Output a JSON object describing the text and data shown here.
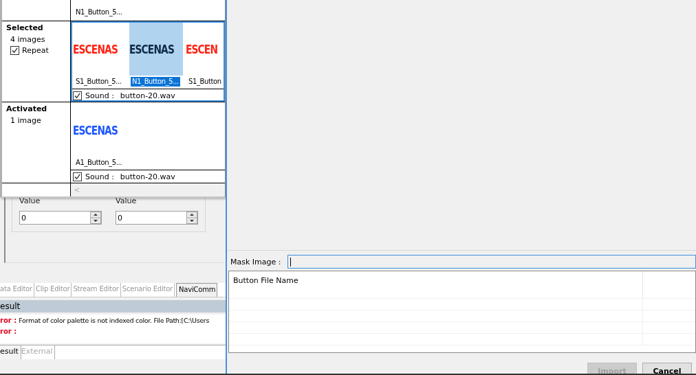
{
  "background_app": {
    "value_fields": [
      {
        "label": "Value",
        "value": "0"
      },
      {
        "label": "Value",
        "value": "0"
      }
    ],
    "editor_tabs": [
      {
        "label": "ata Editor",
        "selected": false
      },
      {
        "label": "Clip Editor",
        "selected": false
      },
      {
        "label": "Stream Editor",
        "selected": false
      },
      {
        "label": "Scenario Editor",
        "selected": false
      },
      {
        "label": "NaviComm",
        "selected": true
      }
    ],
    "result_panel": {
      "title": "esult",
      "messages": [
        {
          "level": "ror :",
          "text": "Format of color palette is not indexed color. File Path:[C:\\Users"
        },
        {
          "level": "ror :"
        }
      ]
    },
    "bottom_tabs": [
      {
        "label": "esult",
        "selected": true
      },
      {
        "label": "External",
        "selected": false
      }
    ]
  },
  "state_table": {
    "top_row": {
      "thumbnails": [
        {
          "label": "N1_Button_5...",
          "selected": false
        }
      ]
    },
    "rows": [
      {
        "state": "Selected",
        "count": "4 images",
        "repeat": {
          "label": "Repeat",
          "checked": true
        },
        "focused": true,
        "thumbnails": [
          {
            "image_text": "ESCENAS",
            "color": "#ff2314",
            "label": "S1_Button_5...",
            "selected": false
          },
          {
            "image_text": "ESCENAS",
            "color": "#0e2a48",
            "label": "N1_Button_5...",
            "selected": true
          },
          {
            "image_text": "ESCEN",
            "color": "#ff2314",
            "label": "S1_Button",
            "selected": false
          }
        ],
        "sound": {
          "label": "Sound :",
          "file": "button-20.wav",
          "checked": true
        }
      },
      {
        "state": "Activated",
        "count": "1 image",
        "focused": false,
        "thumbnails": [
          {
            "image_text": "ESCENAS",
            "color": "#1a55ff",
            "label": "A1_Button_5...",
            "selected": false
          }
        ],
        "sound": {
          "label": "Sound :",
          "file": "button-20.wav",
          "checked": true
        }
      }
    ],
    "scroll_arrow": "<"
  },
  "dialog": {
    "mask_image": {
      "label": "Mask Image :"
    },
    "list": {
      "columns": [
        "Button File Name"
      ]
    },
    "buttons": [
      {
        "label": "Import",
        "disabled": true
      },
      {
        "label": "Cancel",
        "disabled": false
      }
    ]
  }
}
